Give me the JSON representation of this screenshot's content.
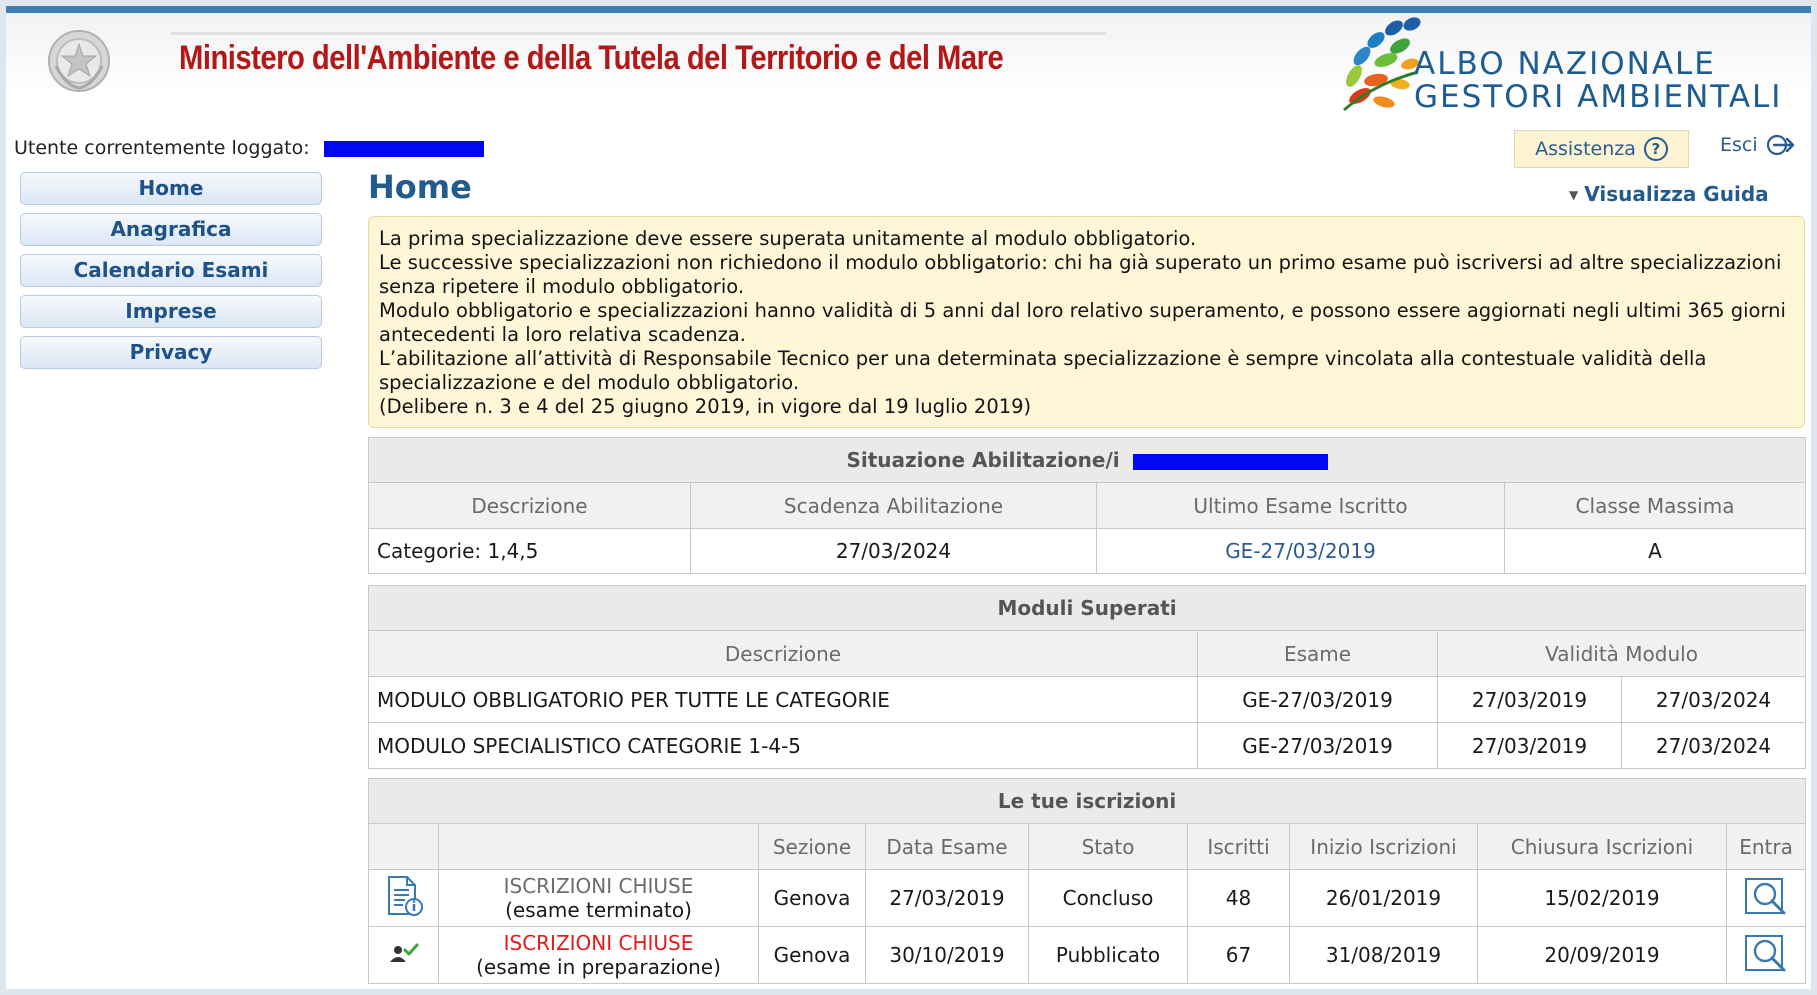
{
  "header": {
    "ministry_title": "Ministero dell'Ambiente e della Tutela del Territorio e del Mare",
    "albo_line1": "ALBO NAZIONALE",
    "albo_line2": "GESTORI AMBIENTALI",
    "user_label": "Utente correntemente loggato:",
    "assistenza_label": "Assistenza",
    "esci_label": "Esci"
  },
  "sidebar": {
    "items": [
      {
        "label": "Home"
      },
      {
        "label": "Anagrafica"
      },
      {
        "label": "Calendario Esami"
      },
      {
        "label": "Imprese"
      },
      {
        "label": "Privacy"
      }
    ]
  },
  "main": {
    "title": "Home",
    "guide_link": "Visualizza Guida",
    "info_lines": [
      "La prima specializzazione deve essere superata unitamente al modulo obbligatorio.",
      "Le successive specializzazioni non richiedono il modulo obbligatorio: chi ha già superato un primo esame può iscriversi ad altre specializzazioni senza ripetere il modulo obbligatorio.",
      "Modulo obbligatorio e specializzazioni hanno validità di 5 anni dal loro relativo superamento, e possono essere aggiornati negli ultimi 365 giorni antecedenti la loro relativa scadenza.",
      "L’abilitazione all’attività di Responsabile Tecnico per una determinata specializzazione è sempre vincolata alla contestuale validità della specializzazione e del modulo obbligatorio.",
      "(Delibere n. 3 e 4 del 25 giugno 2019, in vigore dal 19 luglio 2019)"
    ]
  },
  "abilitazioni": {
    "caption": "Situazione Abilitazione/i",
    "headers": [
      "Descrizione",
      "Scadenza Abilitazione",
      "Ultimo Esame Iscritto",
      "Classe Massima"
    ],
    "row": {
      "descrizione": "Categorie: 1,4,5",
      "scadenza": "27/03/2024",
      "ultimo_esame": "GE-27/03/2019",
      "classe": "A"
    }
  },
  "moduli": {
    "caption": "Moduli Superati",
    "headers": [
      "Descrizione",
      "Esame",
      "Validità Modulo"
    ],
    "rows": [
      {
        "descrizione": "MODULO OBBLIGATORIO PER TUTTE LE CATEGORIE",
        "esame": "GE-27/03/2019",
        "dal": "27/03/2019",
        "al": "27/03/2024"
      },
      {
        "descrizione": "MODULO SPECIALISTICO CATEGORIE 1-4-5",
        "esame": "GE-27/03/2019",
        "dal": "27/03/2019",
        "al": "27/03/2024"
      }
    ]
  },
  "iscrizioni": {
    "caption": "Le tue iscrizioni",
    "headers": [
      "Sezione",
      "Data Esame",
      "Stato",
      "Iscritti",
      "Inizio Iscrizioni",
      "Chiusura Iscrizioni",
      "Entra"
    ],
    "rows": [
      {
        "icon": "document-info-icon",
        "status_line1": "ISCRIZIONI CHIUSE",
        "status_line2": "(esame terminato)",
        "status_color": "#6c6c6c",
        "sezione": "Genova",
        "data_esame": "27/03/2019",
        "stato": "Concluso",
        "iscritti": "48",
        "inizio": "26/01/2019",
        "chiusura": "15/02/2019"
      },
      {
        "icon": "user-check-icon",
        "status_line1": "ISCRIZIONI CHIUSE",
        "status_line2": "(esame in preparazione)",
        "status_color": "#e51b1b",
        "sezione": "Genova",
        "data_esame": "30/10/2019",
        "stato": "Pubblicato",
        "iscritti": "67",
        "inizio": "31/08/2019",
        "chiusura": "20/09/2019"
      }
    ]
  },
  "colors": {
    "ministry_red": "#b31818",
    "brand_blue": "#1c5c93",
    "link_blue": "#2a5c90",
    "redaction": "#0008f0",
    "info_bg": "#fef6d6"
  }
}
